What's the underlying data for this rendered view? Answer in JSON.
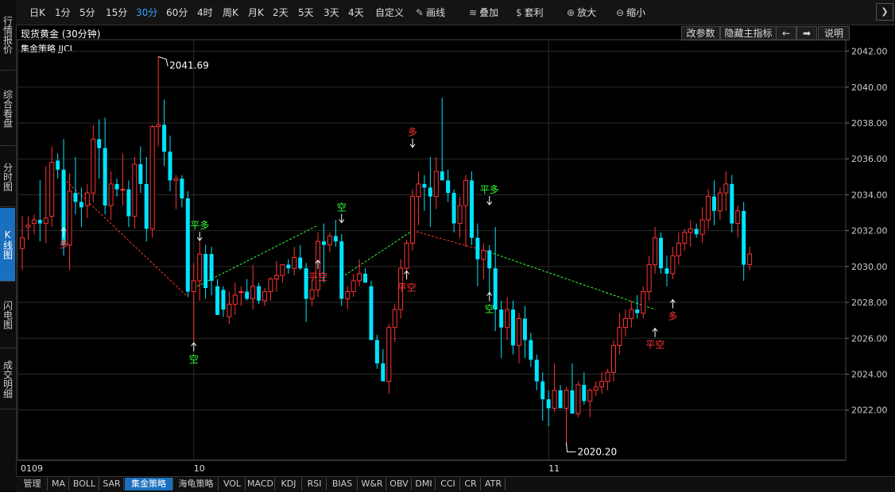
{
  "left_tabs": [
    {
      "label": "行情报价",
      "active": false
    },
    {
      "label": "综合看盘",
      "active": false
    },
    {
      "label": "分时图",
      "active": false
    },
    {
      "label": "K线图",
      "active": true
    },
    {
      "label": "闪电图",
      "active": false
    },
    {
      "label": "成交明细",
      "active": false
    }
  ],
  "toolbar": {
    "periods": [
      {
        "label": "日K",
        "active": false
      },
      {
        "label": "1分",
        "active": false
      },
      {
        "label": "5分",
        "active": false
      },
      {
        "label": "15分",
        "active": false
      },
      {
        "label": "30分",
        "active": true
      },
      {
        "label": "60分",
        "active": false
      },
      {
        "label": "4时",
        "active": false
      },
      {
        "label": "周K",
        "active": false
      },
      {
        "label": "月K",
        "active": false
      },
      {
        "label": "2天",
        "active": false
      },
      {
        "label": "5天",
        "active": false
      },
      {
        "label": "3天",
        "active": false
      },
      {
        "label": "4天",
        "active": false
      },
      {
        "label": "自定义",
        "active": false
      }
    ],
    "tools": [
      {
        "label": "画线",
        "icon": "pencil-icon",
        "glyph": "✎"
      },
      {
        "label": "叠加",
        "icon": "stack-icon",
        "glyph": "≋"
      },
      {
        "label": "套利",
        "icon": "money-bag-icon",
        "glyph": "$"
      },
      {
        "label": "放大",
        "icon": "zoom-in-icon",
        "glyph": "⊕"
      },
      {
        "label": "缩小",
        "icon": "zoom-out-icon",
        "glyph": "⊖"
      }
    ],
    "nav_glyph": "❯"
  },
  "header": {
    "title": "现货黄金 (30分钟)",
    "strategy": "集金策略 JJCL",
    "buttons": [
      "改参数",
      "隐藏主指标",
      "←",
      "➡",
      "说明"
    ]
  },
  "colors": {
    "up": "#ff3333",
    "down": "#00e5ff",
    "grid": "#2a2a2a",
    "buy_signal": "#ff3333",
    "sell_signal": "#33ff33"
  },
  "chart_data": {
    "type": "candlestick",
    "ylim": [
      2019.2,
      2042.6
    ],
    "yticks": [
      "2042.00",
      "2040.00",
      "2038.00",
      "2036.00",
      "2034.00",
      "2032.00",
      "2030.00",
      "2028.00",
      "2026.00",
      "2024.00",
      "2022.00"
    ],
    "yvalues": [
      2042,
      2040,
      2038,
      2036,
      2034,
      2032,
      2030,
      2028,
      2026,
      2024,
      2022
    ],
    "xlabels": [
      {
        "label": "0109",
        "index": 0
      },
      {
        "label": "10",
        "index": 29
      },
      {
        "label": "11",
        "index": 89
      }
    ],
    "candles": [
      {
        "o": 2031.0,
        "h": 2032.8,
        "l": 2029.8,
        "c": 2031.6
      },
      {
        "o": 2032.2,
        "h": 2032.8,
        "l": 2031.5,
        "c": 2032.3
      },
      {
        "o": 2032.4,
        "h": 2032.9,
        "l": 2031.8,
        "c": 2032.6
      },
      {
        "o": 2032.6,
        "h": 2034.8,
        "l": 2031.4,
        "c": 2032.4
      },
      {
        "o": 2032.4,
        "h": 2035.6,
        "l": 2031.3,
        "c": 2032.7
      },
      {
        "o": 2032.8,
        "h": 2036.7,
        "l": 2032.2,
        "c": 2035.8
      },
      {
        "o": 2035.9,
        "h": 2036.3,
        "l": 2034.9,
        "c": 2035.4
      },
      {
        "o": 2035.4,
        "h": 2037.1,
        "l": 2030.6,
        "c": 2031.2
      },
      {
        "o": 2031.2,
        "h": 2035.2,
        "l": 2029.8,
        "c": 2034.2
      },
      {
        "o": 2034.1,
        "h": 2036.1,
        "l": 2032.9,
        "c": 2033.6
      },
      {
        "o": 2033.6,
        "h": 2034.4,
        "l": 2032.2,
        "c": 2033.3
      },
      {
        "o": 2033.4,
        "h": 2034.6,
        "l": 2032.7,
        "c": 2034.1
      },
      {
        "o": 2034.1,
        "h": 2037.9,
        "l": 2033.6,
        "c": 2037.1
      },
      {
        "o": 2037.1,
        "h": 2038.2,
        "l": 2034.9,
        "c": 2036.6
      },
      {
        "o": 2036.6,
        "h": 2038.3,
        "l": 2032.9,
        "c": 2033.4
      },
      {
        "o": 2033.4,
        "h": 2035.3,
        "l": 2032.6,
        "c": 2034.6
      },
      {
        "o": 2034.6,
        "h": 2034.9,
        "l": 2033.9,
        "c": 2034.3
      },
      {
        "o": 2034.3,
        "h": 2036.3,
        "l": 2033.4,
        "c": 2034.3
      },
      {
        "o": 2034.3,
        "h": 2034.8,
        "l": 2032.2,
        "c": 2032.8
      },
      {
        "o": 2032.8,
        "h": 2036.1,
        "l": 2032.1,
        "c": 2035.7
      },
      {
        "o": 2035.7,
        "h": 2036.7,
        "l": 2034.1,
        "c": 2034.6
      },
      {
        "o": 2034.6,
        "h": 2036.1,
        "l": 2031.4,
        "c": 2032.1
      },
      {
        "o": 2032.1,
        "h": 2037.9,
        "l": 2031.6,
        "c": 2037.8
      },
      {
        "o": 2037.8,
        "h": 2041.7,
        "l": 2036.7,
        "c": 2037.9
      },
      {
        "o": 2037.9,
        "h": 2039.3,
        "l": 2035.6,
        "c": 2036.4
      },
      {
        "o": 2036.4,
        "h": 2037.3,
        "l": 2034.2,
        "c": 2034.8
      },
      {
        "o": 2034.8,
        "h": 2035.1,
        "l": 2033.2,
        "c": 2034.9
      },
      {
        "o": 2034.9,
        "h": 2035.1,
        "l": 2033.3,
        "c": 2033.8
      },
      {
        "o": 2033.8,
        "h": 2034.2,
        "l": 2028.3,
        "c": 2028.6
      },
      {
        "o": 2028.6,
        "h": 2030.2,
        "l": 2025.8,
        "c": 2029.2
      },
      {
        "o": 2029.2,
        "h": 2031.4,
        "l": 2028.1,
        "c": 2030.7
      },
      {
        "o": 2030.7,
        "h": 2031.2,
        "l": 2028.2,
        "c": 2028.8
      },
      {
        "o": 2030.7,
        "h": 2031.1,
        "l": 2028.4,
        "c": 2029.2
      },
      {
        "o": 2028.9,
        "h": 2029.3,
        "l": 2027.3,
        "c": 2027.3
      },
      {
        "o": 2028.7,
        "h": 2028.9,
        "l": 2027.2,
        "c": 2027.6
      },
      {
        "o": 2027.2,
        "h": 2028.6,
        "l": 2026.8,
        "c": 2027.9
      },
      {
        "o": 2027.9,
        "h": 2029.1,
        "l": 2027.3,
        "c": 2028.4
      },
      {
        "o": 2028.6,
        "h": 2028.9,
        "l": 2027.8,
        "c": 2028.6
      },
      {
        "o": 2028.6,
        "h": 2029.3,
        "l": 2028.1,
        "c": 2028.2
      },
      {
        "o": 2028.2,
        "h": 2030.1,
        "l": 2027.6,
        "c": 2028.9
      },
      {
        "o": 2028.9,
        "h": 2029.1,
        "l": 2027.9,
        "c": 2028.1
      },
      {
        "o": 2028.1,
        "h": 2028.8,
        "l": 2027.8,
        "c": 2028.6
      },
      {
        "o": 2028.6,
        "h": 2029.4,
        "l": 2028.1,
        "c": 2029.3
      },
      {
        "o": 2029.3,
        "h": 2030.3,
        "l": 2028.6,
        "c": 2029.5
      },
      {
        "o": 2029.5,
        "h": 2030.1,
        "l": 2029.1,
        "c": 2030.1
      },
      {
        "o": 2030.1,
        "h": 2030.4,
        "l": 2029.6,
        "c": 2029.9
      },
      {
        "o": 2029.9,
        "h": 2031.1,
        "l": 2029.5,
        "c": 2030.5
      },
      {
        "o": 2030.5,
        "h": 2031.2,
        "l": 2029.8,
        "c": 2029.9
      },
      {
        "o": 2029.9,
        "h": 2030.2,
        "l": 2026.9,
        "c": 2028.2
      },
      {
        "o": 2028.2,
        "h": 2029.3,
        "l": 2027.8,
        "c": 2028.7
      },
      {
        "o": 2028.7,
        "h": 2031.9,
        "l": 2028.3,
        "c": 2031.4
      },
      {
        "o": 2031.4,
        "h": 2032.4,
        "l": 2029.1,
        "c": 2031.2
      },
      {
        "o": 2031.2,
        "h": 2031.9,
        "l": 2030.8,
        "c": 2031.7
      },
      {
        "o": 2031.7,
        "h": 2032.6,
        "l": 2031.1,
        "c": 2031.4
      },
      {
        "o": 2031.4,
        "h": 2031.8,
        "l": 2027.8,
        "c": 2028.2
      },
      {
        "o": 2028.2,
        "h": 2028.9,
        "l": 2027.6,
        "c": 2028.6
      },
      {
        "o": 2028.6,
        "h": 2029.6,
        "l": 2028.3,
        "c": 2029.2
      },
      {
        "o": 2029.2,
        "h": 2030.4,
        "l": 2028.9,
        "c": 2029.6
      },
      {
        "o": 2029.6,
        "h": 2029.9,
        "l": 2029.1,
        "c": 2029.1
      },
      {
        "o": 2028.9,
        "h": 2029.2,
        "l": 2025.9,
        "c": 2025.9
      },
      {
        "o": 2025.9,
        "h": 2026.2,
        "l": 2024.3,
        "c": 2024.6
      },
      {
        "o": 2024.6,
        "h": 2025.4,
        "l": 2023.6,
        "c": 2023.6
      },
      {
        "o": 2023.6,
        "h": 2026.8,
        "l": 2022.9,
        "c": 2026.6
      },
      {
        "o": 2026.6,
        "h": 2027.9,
        "l": 2025.8,
        "c": 2027.6
      },
      {
        "o": 2027.6,
        "h": 2030.4,
        "l": 2027.1,
        "c": 2029.9
      },
      {
        "o": 2029.9,
        "h": 2031.5,
        "l": 2029.4,
        "c": 2031.3
      },
      {
        "o": 2031.3,
        "h": 2034.3,
        "l": 2030.9,
        "c": 2033.9
      },
      {
        "o": 2033.9,
        "h": 2035.3,
        "l": 2032.3,
        "c": 2034.6
      },
      {
        "o": 2034.6,
        "h": 2035.1,
        "l": 2033.1,
        "c": 2034.4
      },
      {
        "o": 2034.4,
        "h": 2036.1,
        "l": 2032.2,
        "c": 2033.9
      },
      {
        "o": 2033.9,
        "h": 2036.1,
        "l": 2033.2,
        "c": 2035.3
      },
      {
        "o": 2035.3,
        "h": 2039.4,
        "l": 2034.9,
        "c": 2034.8
      },
      {
        "o": 2034.8,
        "h": 2035.4,
        "l": 2033.6,
        "c": 2034.1
      },
      {
        "o": 2034.1,
        "h": 2034.3,
        "l": 2031.9,
        "c": 2032.4
      },
      {
        "o": 2032.4,
        "h": 2033.9,
        "l": 2031.6,
        "c": 2033.4
      },
      {
        "o": 2033.4,
        "h": 2035.1,
        "l": 2031.1,
        "c": 2034.8
      },
      {
        "o": 2034.8,
        "h": 2035.3,
        "l": 2031.2,
        "c": 2031.6
      },
      {
        "o": 2031.6,
        "h": 2032.4,
        "l": 2028.9,
        "c": 2030.4
      },
      {
        "o": 2030.4,
        "h": 2031.3,
        "l": 2029.3,
        "c": 2030.9
      },
      {
        "o": 2030.9,
        "h": 2031.2,
        "l": 2028.4,
        "c": 2029.9
      },
      {
        "o": 2029.9,
        "h": 2032.2,
        "l": 2026.4,
        "c": 2027.6
      },
      {
        "o": 2027.6,
        "h": 2028.1,
        "l": 2024.9,
        "c": 2026.6
      },
      {
        "o": 2026.6,
        "h": 2028.3,
        "l": 2025.9,
        "c": 2027.6
      },
      {
        "o": 2027.6,
        "h": 2028.1,
        "l": 2025.1,
        "c": 2025.6
      },
      {
        "o": 2025.6,
        "h": 2027.4,
        "l": 2024.6,
        "c": 2027.1
      },
      {
        "o": 2027.1,
        "h": 2027.8,
        "l": 2024.9,
        "c": 2025.9
      },
      {
        "o": 2025.9,
        "h": 2026.3,
        "l": 2024.4,
        "c": 2024.8
      },
      {
        "o": 2024.8,
        "h": 2025.1,
        "l": 2023.1,
        "c": 2023.6
      },
      {
        "o": 2023.6,
        "h": 2024.1,
        "l": 2021.4,
        "c": 2022.6
      },
      {
        "o": 2022.6,
        "h": 2023.1,
        "l": 2021.1,
        "c": 2022.1
      },
      {
        "o": 2022.1,
        "h": 2024.6,
        "l": 2021.9,
        "c": 2023.1
      },
      {
        "o": 2023.1,
        "h": 2023.4,
        "l": 2022.1,
        "c": 2022.1
      },
      {
        "o": 2022.1,
        "h": 2023.3,
        "l": 2020.2,
        "c": 2023.1
      },
      {
        "o": 2023.1,
        "h": 2024.6,
        "l": 2021.9,
        "c": 2021.8
      },
      {
        "o": 2021.8,
        "h": 2023.6,
        "l": 2021.6,
        "c": 2023.4
      },
      {
        "o": 2023.4,
        "h": 2024.1,
        "l": 2022.3,
        "c": 2022.5
      },
      {
        "o": 2022.5,
        "h": 2023.2,
        "l": 2021.6,
        "c": 2023.1
      },
      {
        "o": 2023.1,
        "h": 2023.6,
        "l": 2022.8,
        "c": 2023.3
      },
      {
        "o": 2023.3,
        "h": 2024.1,
        "l": 2022.9,
        "c": 2023.6
      },
      {
        "o": 2023.6,
        "h": 2024.3,
        "l": 2023.1,
        "c": 2024.1
      },
      {
        "o": 2024.1,
        "h": 2025.9,
        "l": 2023.6,
        "c": 2025.6
      },
      {
        "o": 2025.6,
        "h": 2027.4,
        "l": 2025.1,
        "c": 2026.6
      },
      {
        "o": 2026.6,
        "h": 2027.6,
        "l": 2026.1,
        "c": 2027.1
      },
      {
        "o": 2027.1,
        "h": 2028.1,
        "l": 2026.6,
        "c": 2027.6
      },
      {
        "o": 2027.6,
        "h": 2028.4,
        "l": 2027.1,
        "c": 2027.4
      },
      {
        "o": 2027.4,
        "h": 2028.9,
        "l": 2027.1,
        "c": 2028.6
      },
      {
        "o": 2028.6,
        "h": 2030.6,
        "l": 2028.1,
        "c": 2030.1
      },
      {
        "o": 2030.1,
        "h": 2032.2,
        "l": 2029.6,
        "c": 2031.6
      },
      {
        "o": 2031.6,
        "h": 2031.9,
        "l": 2029.6,
        "c": 2029.9
      },
      {
        "o": 2029.9,
        "h": 2030.6,
        "l": 2028.9,
        "c": 2029.6
      },
      {
        "o": 2029.6,
        "h": 2031.1,
        "l": 2029.3,
        "c": 2030.6
      },
      {
        "o": 2030.6,
        "h": 2031.9,
        "l": 2030.1,
        "c": 2031.3
      },
      {
        "o": 2031.3,
        "h": 2032.1,
        "l": 2030.9,
        "c": 2031.9
      },
      {
        "o": 2031.9,
        "h": 2032.6,
        "l": 2031.1,
        "c": 2032.1
      },
      {
        "o": 2032.1,
        "h": 2032.4,
        "l": 2031.6,
        "c": 2031.8
      },
      {
        "o": 2031.8,
        "h": 2033.3,
        "l": 2031.3,
        "c": 2032.6
      },
      {
        "o": 2032.6,
        "h": 2034.3,
        "l": 2032.1,
        "c": 2033.9
      },
      {
        "o": 2033.9,
        "h": 2034.8,
        "l": 2032.3,
        "c": 2033.1
      },
      {
        "o": 2033.1,
        "h": 2034.4,
        "l": 2032.6,
        "c": 2034.1
      },
      {
        "o": 2034.1,
        "h": 2035.3,
        "l": 2033.1,
        "c": 2034.6
      },
      {
        "o": 2034.6,
        "h": 2035.1,
        "l": 2031.9,
        "c": 2032.4
      },
      {
        "o": 2032.4,
        "h": 2033.4,
        "l": 2031.6,
        "c": 2033.1
      },
      {
        "o": 2033.1,
        "h": 2033.6,
        "l": 2029.2,
        "c": 2030.1
      },
      {
        "o": 2030.1,
        "h": 2031.1,
        "l": 2029.8,
        "c": 2030.7
      }
    ],
    "markers": [
      {
        "text": "2041.69",
        "index": 23,
        "price": 2041.69,
        "side": "high"
      },
      {
        "text": "2020.20",
        "index": 92,
        "price": 2020.2,
        "side": "low"
      }
    ],
    "signals": [
      {
        "label": "多",
        "index": 7,
        "price": 2032.2,
        "dir": "up",
        "color": "buy"
      },
      {
        "label": "平多",
        "index": 30,
        "price": 2031.4,
        "dir": "down",
        "color": "sell"
      },
      {
        "label": "空",
        "index": 29,
        "price": 2025.8,
        "dir": "up",
        "color": "sell"
      },
      {
        "label": "平空",
        "index": 50,
        "price": 2030.4,
        "dir": "up",
        "color": "buy"
      },
      {
        "label": "空",
        "index": 54,
        "price": 2032.4,
        "dir": "down",
        "color": "sell"
      },
      {
        "label": "平空",
        "index": 65,
        "price": 2029.8,
        "dir": "up",
        "color": "buy"
      },
      {
        "label": "多",
        "index": 66,
        "price": 2036.6,
        "dir": "down",
        "color": "buy"
      },
      {
        "label": "平多",
        "index": 79,
        "price": 2033.4,
        "dir": "down",
        "color": "sell"
      },
      {
        "label": "空",
        "index": 79,
        "price": 2028.6,
        "dir": "up",
        "color": "sell"
      },
      {
        "label": "平空",
        "index": 107,
        "price": 2026.6,
        "dir": "up",
        "color": "buy"
      },
      {
        "label": "多",
        "index": 110,
        "price": 2028.2,
        "dir": "up",
        "color": "buy"
      }
    ],
    "trend_lines": [
      {
        "from": [
          7,
          2034.9
        ],
        "to": [
          28,
          2028.3
        ],
        "color": "red"
      },
      {
        "from": [
          29,
          2028.8
        ],
        "to": [
          50,
          2032.3
        ],
        "color": "green"
      },
      {
        "from": [
          54,
          2029.4
        ],
        "to": [
          66,
          2032.0
        ],
        "color": "green"
      },
      {
        "from": [
          66,
          2032.0
        ],
        "to": [
          79,
          2030.8
        ],
        "color": "red"
      },
      {
        "from": [
          79,
          2030.8
        ],
        "to": [
          107,
          2027.6
        ],
        "color": "green"
      }
    ]
  },
  "bottom_tabs": [
    {
      "label": "管理",
      "active": false
    },
    {
      "label": "MA",
      "active": false
    },
    {
      "label": "BOLL",
      "active": false
    },
    {
      "label": "SAR",
      "active": false
    },
    {
      "label": "集金策略",
      "active": true
    },
    {
      "label": "海龟策略",
      "active": false
    },
    {
      "label": "VOL",
      "active": false
    },
    {
      "label": "MACD",
      "active": false
    },
    {
      "label": "KDJ",
      "active": false
    },
    {
      "label": "RSI",
      "active": false
    },
    {
      "label": "BIAS",
      "active": false
    },
    {
      "label": "W&R",
      "active": false
    },
    {
      "label": "OBV",
      "active": false
    },
    {
      "label": "DMI",
      "active": false
    },
    {
      "label": "CCI",
      "active": false
    },
    {
      "label": "CR",
      "active": false
    },
    {
      "label": "ATR",
      "active": false
    }
  ]
}
